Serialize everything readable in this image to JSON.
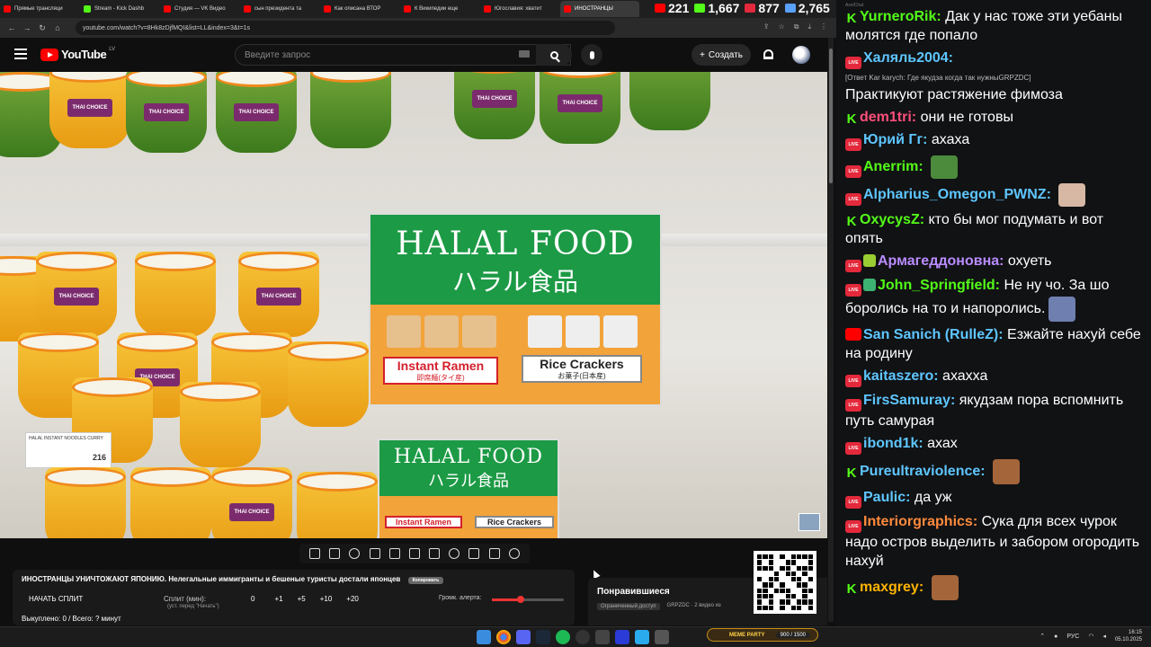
{
  "browser": {
    "tabs": [
      {
        "label": "Прямые трансляци",
        "icon": "youtube-favicon",
        "active": false
      },
      {
        "label": "Stream - Kick Dashb",
        "icon": "kick-favicon",
        "active": false
      },
      {
        "label": "Студия — VK Видео",
        "icon": "youtube-favicon",
        "active": false
      },
      {
        "label": "сын президента та",
        "icon": "youtube-favicon",
        "active": false
      },
      {
        "label": "Как описана ВТОР",
        "icon": "youtube-favicon",
        "active": false
      },
      {
        "label": "К Википедии еще",
        "icon": "youtube-favicon",
        "active": false
      },
      {
        "label": "Югославия: хватит",
        "icon": "youtube-favicon",
        "active": false
      },
      {
        "label": "ИНОСТРАНЦЫ",
        "icon": "youtube-favicon",
        "active": true
      }
    ],
    "url": "youtube.com/watch?v=8Hk8zDjfMQI&list=LL&index=3&t=1s"
  },
  "stream_stats": [
    {
      "platform": "youtube",
      "count": "221",
      "color": "#ff0000"
    },
    {
      "platform": "kick",
      "count": "1,667",
      "color": "#53fc18"
    },
    {
      "platform": "live",
      "count": "877",
      "color": "#e3293b"
    },
    {
      "platform": "total",
      "count": "2,765",
      "color": "#5aa0ff"
    }
  ],
  "youtube": {
    "logo_text": "YouTube",
    "region": "LV",
    "search_placeholder": "Введите запрос",
    "create_label": "Создать"
  },
  "video_overlay": {
    "sign_title": "HALAL FOOD",
    "sign_jp": "ハラル食品",
    "product_1": "Instant Ramen",
    "product_1_sub": "即席麺(タイ産)",
    "product_2": "Rice Crackers",
    "product_2_sub": "お菓子(日本産)",
    "cup_label": "THAI CHOICE",
    "pricetag_text": "HALAL INSTANT NOODLES CURRY",
    "price": "216"
  },
  "info": {
    "title": "ИНОСТРАНЦЫ УНИЧТОЖАЮТ ЯПОНИЮ. Нелегальные иммигранты и бешеные туристы достали японцев",
    "copy_button": "Копировать",
    "split_start": "НАЧАТЬ СПЛИТ",
    "split_label": "Сплит (мин):",
    "split_sub": "(уст. перед \"Начать\")",
    "split_values": [
      "0",
      "+1",
      "+5",
      "+10",
      "+20"
    ],
    "alert_label": "Громк. алерта:",
    "alert_volume": 0.4,
    "bought": "Выкуплено: 0 / Всего: ? минут"
  },
  "liked": {
    "title": "Понравившиеся",
    "limited": "Ограниченный доступ",
    "meta": "GRPZDC · 2 видео из"
  },
  "chat": {
    "app_title": "AxelChat",
    "messages": [
      {
        "platform": "kick",
        "nick": "YurneroRik",
        "color": "#53fc18",
        "text": "Дак у нас тоже эти уебаны молятся где попало"
      },
      {
        "platform": "live",
        "nick": "Халяль2004",
        "color": "#5ec6ff",
        "reply": "[Ответ Kar karych: Где якудза когда так нужныGRPZDC]",
        "text": "Практикуют растяжение фимоза"
      },
      {
        "platform": "kick",
        "nick": "dem1tri",
        "color": "#ff4f7b",
        "text": "они не готовы"
      },
      {
        "platform": "live",
        "nick": "Юрий Гг",
        "color": "#5ec6ff",
        "text": "ахаха"
      },
      {
        "platform": "live",
        "nick": "Anerrim",
        "color": "#53fc18",
        "text": "",
        "emote": "pepe-emote"
      },
      {
        "platform": "live",
        "nick": "Alpharius_Omegon_PWNZ",
        "color": "#5ec6ff",
        "text": "",
        "emote": "face-emote"
      },
      {
        "platform": "kick",
        "nick": "OxycysZ",
        "color": "#53fc18",
        "text": "кто бы мог подумать и вот опять"
      },
      {
        "platform": "live",
        "nick": "Армагеддоновна",
        "color": "#b98cff",
        "text": "охуеть",
        "extra_badge": "shield"
      },
      {
        "platform": "live",
        "nick": "John_Springfield",
        "color": "#53fc18",
        "text": "Не ну чо. За шо боролись на то и напоролись.",
        "extra_badge": "pen",
        "emote": "trump-emote"
      },
      {
        "platform": "youtube",
        "nick": "San Sanich (RulleZ)",
        "color": "#5ec6ff",
        "text": "Езжайте нахуй себе на родину"
      },
      {
        "platform": "live",
        "nick": "kaitaszero",
        "color": "#5ec6ff",
        "text": "ахахха"
      },
      {
        "platform": "live",
        "nick": "FirsSamuray",
        "color": "#5ec6ff",
        "text": "якудзам пора вспомнить путь самурая"
      },
      {
        "platform": "live",
        "nick": "ibond1k",
        "color": "#5ec6ff",
        "text": "ахах"
      },
      {
        "platform": "kick",
        "nick": "Pureultraviolence",
        "color": "#5ec6ff",
        "text": "",
        "emote": "laugh-emote"
      },
      {
        "platform": "live",
        "nick": "Paulic",
        "color": "#5ec6ff",
        "text": "да уж"
      },
      {
        "platform": "live",
        "nick": "Interiorgraphics",
        "color": "#ff8a3d",
        "text": "Сука для всех чурок надо остров выделить и забором огородить нахуй"
      },
      {
        "platform": "kick",
        "nick": "maxgrey",
        "color": "#ffb400",
        "text": "",
        "emote": "laugh-emote"
      }
    ]
  },
  "taskbar": {
    "meme_label": "MEME PARTY",
    "meme_count": "900 / 1500",
    "lang": "РУС",
    "time": "16:15",
    "date": "05.10.2025"
  }
}
